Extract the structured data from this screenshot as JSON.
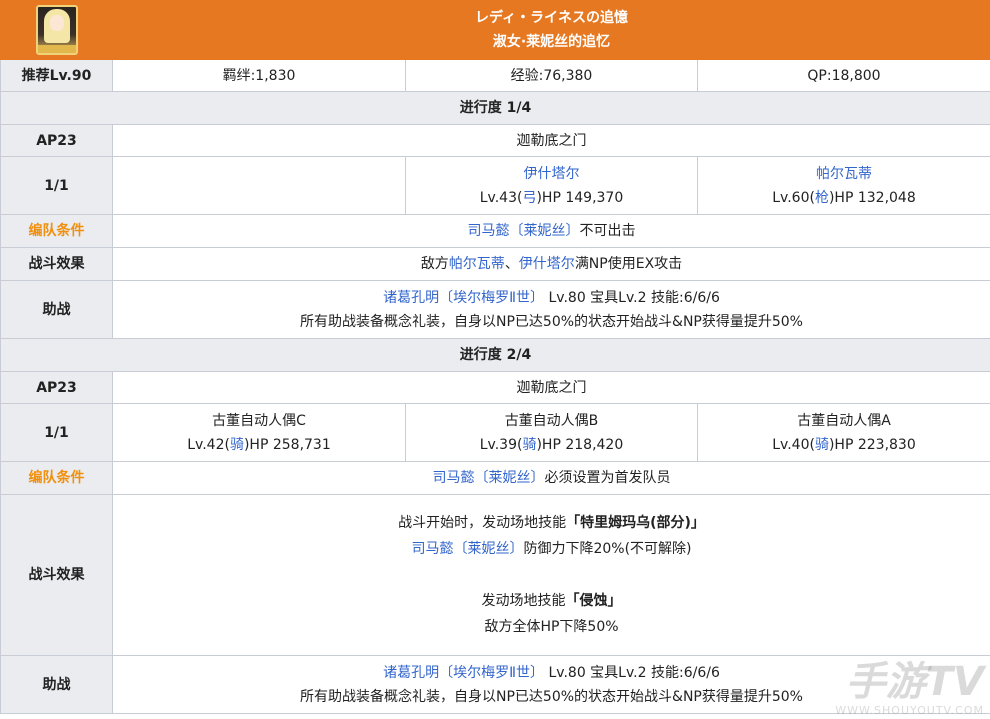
{
  "header": {
    "title_jp": "レディ・ライネスの追憶",
    "title_cn": "淑女·莱妮丝的追忆"
  },
  "summary": {
    "recommend_label": "推荐Lv.90",
    "bond": "羁绊:1,830",
    "exp": "经验:76,380",
    "qp": "QP:18,800"
  },
  "section1": {
    "title": "进行度 1/4",
    "ap_label": "AP23",
    "location": "迦勒底之门",
    "wave_label": "1/1",
    "enemies": [
      {
        "name": "伊什塔尔",
        "lv": "Lv.43(",
        "cls": "弓",
        "hp": ")HP 149,370"
      },
      {
        "name": "帕尔瓦蒂",
        "lv": "Lv.60(",
        "cls": "枪",
        "hp": ")HP 132,048"
      }
    ],
    "team_label": "编队条件",
    "team_servant": "司马懿〔莱妮丝〕",
    "team_cond": "不可出击",
    "effect_label": "战斗效果",
    "effect_prefix": "敌方",
    "effect_t1": "帕尔瓦蒂",
    "effect_sep": "、",
    "effect_t2": "伊什塔尔",
    "effect_suffix": "满NP使用EX攻击",
    "support_label": "助战",
    "support_servant": "诸葛孔明〔埃尔梅罗Ⅱ世〕",
    "support_stats": " Lv.80 宝具Lv.2 技能:6/6/6",
    "support_note": "所有助战装备概念礼装，自身以NP已达50%的状态开始战斗&NP获得量提升50%"
  },
  "section2": {
    "title": "进行度 2/4",
    "ap_label": "AP23",
    "location": "迦勒底之门",
    "wave_label": "1/1",
    "enemies": [
      {
        "name": "古董自动人偶C",
        "lv": "Lv.42(",
        "cls": "骑",
        "hp": ")HP 258,731"
      },
      {
        "name": "古董自动人偶B",
        "lv": "Lv.39(",
        "cls": "骑",
        "hp": ")HP 218,420"
      },
      {
        "name": "古董自动人偶A",
        "lv": "Lv.40(",
        "cls": "骑",
        "hp": ")HP 223,830"
      }
    ],
    "team_label": "编队条件",
    "team_servant": "司马懿〔莱妮丝〕",
    "team_cond": "必须设置为首发队员",
    "effect_label": "战斗效果",
    "effect_line1_prefix": "战斗开始时，发动场地技能",
    "effect_line1_skill": "「特里姆玛乌(部分)」",
    "effect_line2_servant": "司马懿〔莱妮丝〕",
    "effect_line2_text": "防御力下降20%(不可解除)",
    "effect_line3_prefix": "发动场地技能",
    "effect_line3_skill": "「侵蚀」",
    "effect_line4": "敌方全体HP下降50%",
    "support_label": "助战",
    "support_servant": "诸葛孔明〔埃尔梅罗Ⅱ世〕",
    "support_stats": " Lv.80 宝具Lv.2 技能:6/6/6",
    "support_note": "所有助战装备概念礼装，自身以NP已达50%的状态开始战斗&NP获得量提升50%"
  },
  "watermark": {
    "brand": "手游TV",
    "url": "WWW.SHOUYOUTV.COM"
  },
  "colors": {
    "header_bg": "#e67821",
    "label_bg": "#eaecf0",
    "link": "#3366cc",
    "accent_orange": "#f0900f"
  }
}
